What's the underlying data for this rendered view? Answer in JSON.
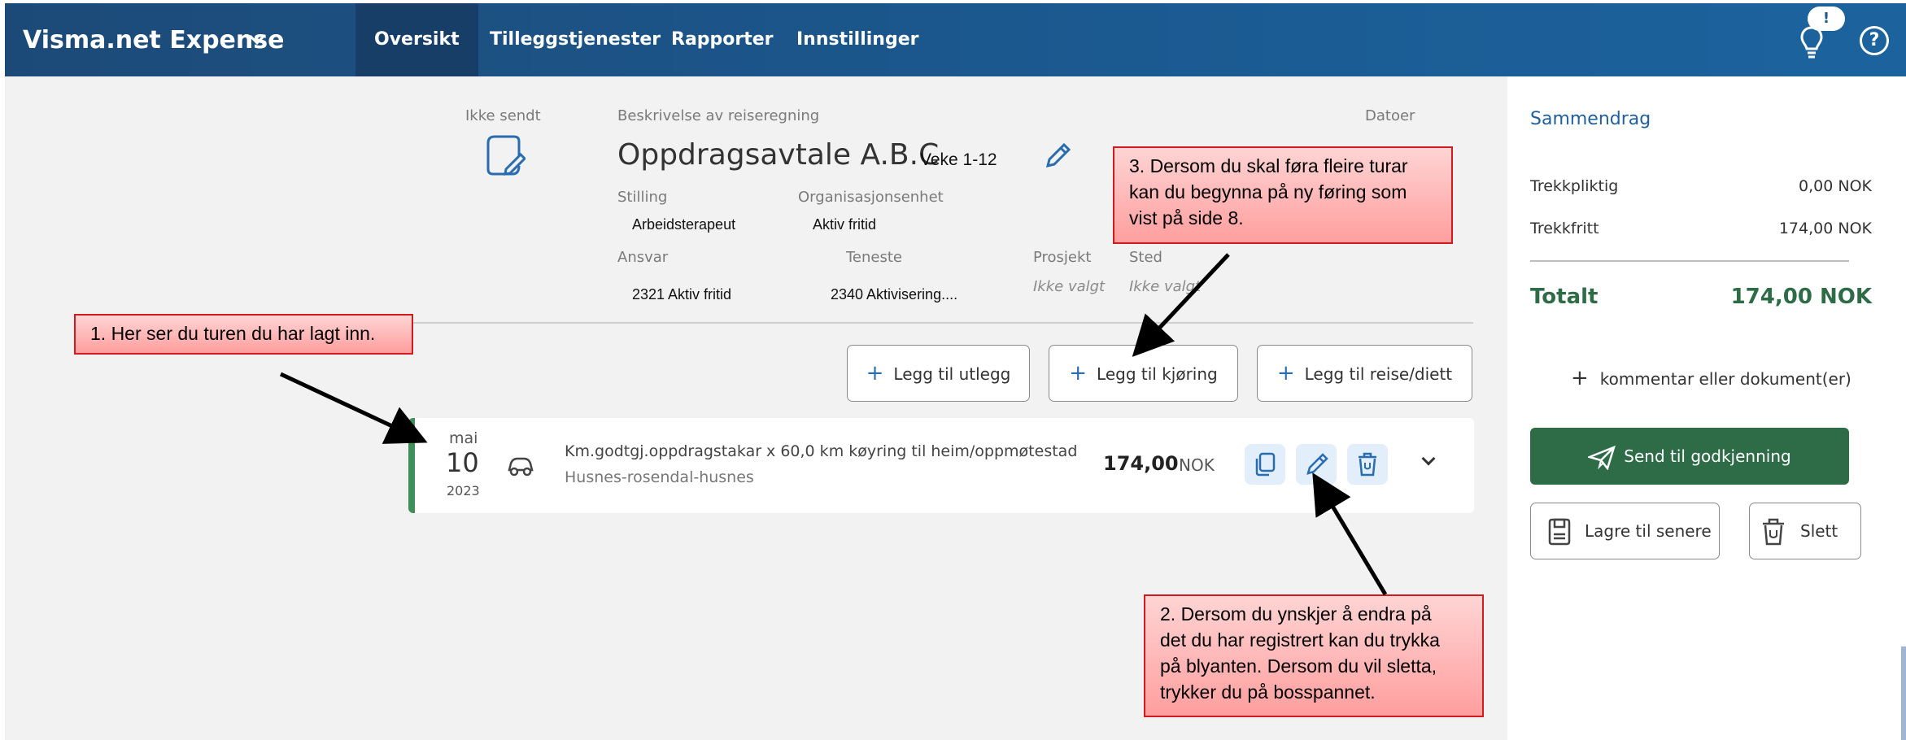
{
  "app": {
    "brand": "Visma.net Expense"
  },
  "nav": {
    "items": [
      "Oversikt",
      "Tilleggstjenester",
      "Rapporter",
      "Innstillinger"
    ],
    "badge": "!",
    "help": "?"
  },
  "report": {
    "status_label": "Ikke sendt",
    "description_label": "Beskrivelse av reiseregning",
    "dates_label": "Datoer",
    "title": "Oppdragsavtale A.B.C",
    "subtitle": "Veke 1-12",
    "fields": {
      "stilling_label": "Stilling",
      "stilling_value": "Arbeidsterapeut",
      "org_label": "Organisasjonsenhet",
      "org_value": "Aktiv fritid",
      "ansvar_label": "Ansvar",
      "ansvar_value": "2321 Aktiv fritid",
      "teneste_label": "Teneste",
      "teneste_value": "2340 Aktivisering....",
      "prosjekt_label": "Prosjekt",
      "prosjekt_value": "Ikke valgt",
      "sted_label": "Sted",
      "sted_value": "Ikke valgt"
    }
  },
  "actions": {
    "add_expense": "Legg til utlegg",
    "add_driving": "Legg til kjøring",
    "add_travel": "Legg til reise/diett",
    "plus": "+"
  },
  "expense": {
    "month": "mai",
    "day": "10",
    "year": "2023",
    "description": "Km.godtgj.oppdragstakar x 60,0 km køyring til heim/oppmøtestad",
    "route": "Husnes-rosendal-husnes",
    "amount": "174,00",
    "currency": "NOK"
  },
  "summary": {
    "title": "Sammendrag",
    "rows": [
      {
        "label": "Trekkpliktig",
        "value": "0,00 NOK"
      },
      {
        "label": "Trekkfritt",
        "value": "174,00 NOK"
      }
    ],
    "total_label": "Totalt",
    "total_value": "174,00 NOK",
    "comment_label": "kommentar eller dokument(er)",
    "send_label": "Send til godkjenning",
    "save_label": "Lagre til senere",
    "delete_label": "Slett"
  },
  "callouts": {
    "c1": "1. Her ser du turen du har lagt inn.",
    "c2": [
      "2. Dersom du ynskjer å endra på",
      "det du har registrert kan du trykka",
      "på blyanten. Dersom du vil sletta,",
      "trykker du på bosspannet."
    ],
    "c3": [
      "3. Dersom du skal føra fleire turar",
      "kan du begynna på ny føring som",
      "vist på side 8."
    ]
  },
  "colors": {
    "topbar": "#1b5a91",
    "nav_active": "#163e66",
    "accent_green": "#2e6b47",
    "row_border": "#3f8f5a",
    "link_blue": "#2a6cb0",
    "callout_border": "#d01c1c"
  }
}
